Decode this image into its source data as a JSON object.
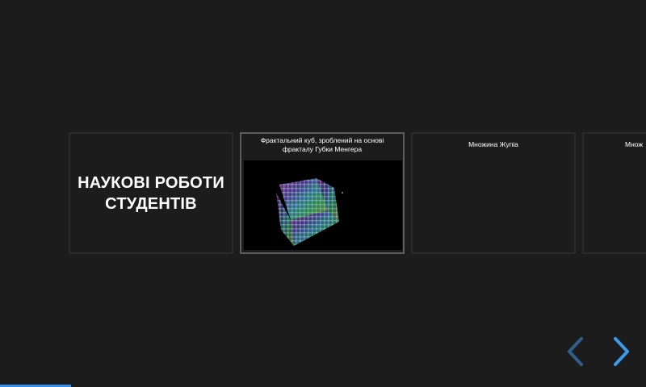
{
  "slider": {
    "title_card": {
      "line1": "НАУКОВІ РОБОТИ",
      "line2": "СТУДЕНТІВ"
    },
    "items": [
      {
        "caption": "Фрактальний куб, зроблений на основі фракталу Губки Менгера",
        "has_image": true,
        "active": true
      },
      {
        "caption": "Множина Жупіа",
        "has_image": false,
        "active": false
      },
      {
        "caption": "Множ",
        "has_image": false,
        "active": false
      }
    ],
    "nav": {
      "prev_icon": "chevron-left-icon",
      "next_icon": "chevron-right-icon",
      "prev_color": "#2f5f8a",
      "next_color": "#3a9be8"
    },
    "progress": {
      "fraction": 0.11,
      "color": "#3a8ee6"
    }
  }
}
